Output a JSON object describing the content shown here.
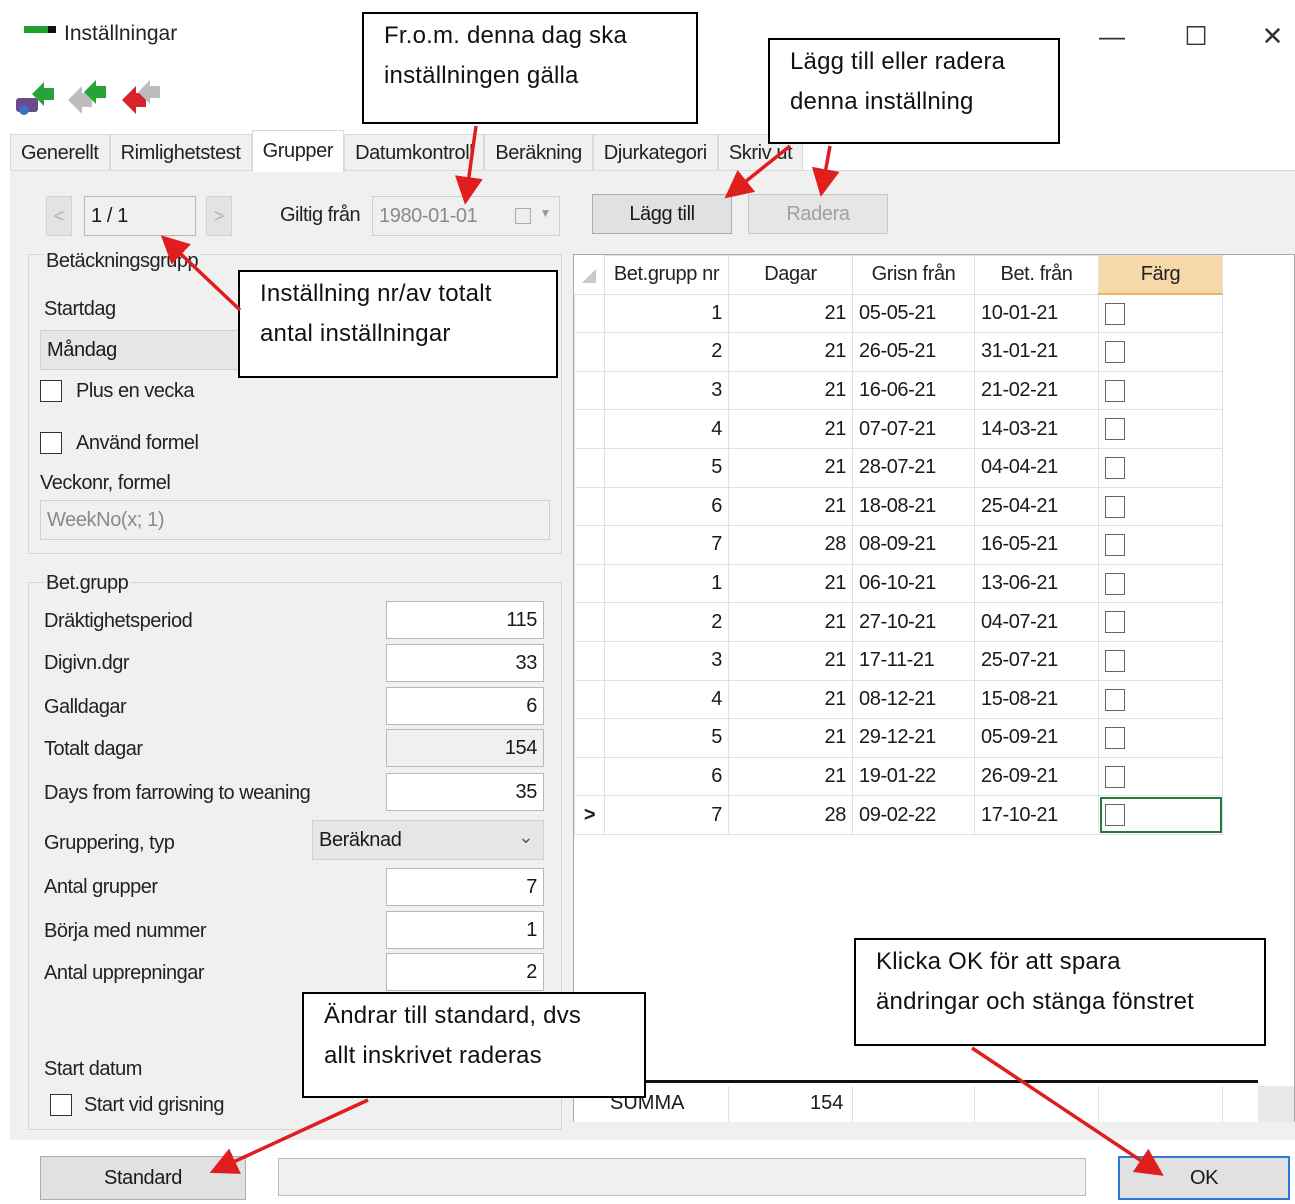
{
  "window": {
    "title": "Inställningar",
    "minimize_glyph": "—",
    "maximize_glyph": "☐",
    "close_glyph": "✕"
  },
  "toolbar": {
    "icons": [
      "add-setting-icon",
      "copy-setting-icon",
      "delete-setting-icon"
    ]
  },
  "tabs": [
    "Generellt",
    "Rimlighetstest",
    "Grupper",
    "Datumkontroll",
    "Beräkning",
    "Djurkategori",
    "Skriv ut"
  ],
  "active_tab": "Grupper",
  "navigator": {
    "prev": "<",
    "next": ">",
    "position": "1 / 1"
  },
  "valid_from": {
    "label": "Giltig från",
    "value": "1980-01-01"
  },
  "buttons": {
    "add": "Lägg till",
    "delete": "Radera",
    "standard": "Standard",
    "ok": "OK"
  },
  "betackning": {
    "group_title": "Betäckningsgrupp",
    "startdag_label": "Startdag",
    "startdag_value": "Måndag",
    "plus_week_label": "Plus en vecka",
    "use_formula_label": "Använd formel",
    "formula_label": "Veckonr, formel",
    "formula_value": "WeekNo(x; 1)"
  },
  "betgrupp": {
    "group_title": "Bet.grupp",
    "drakt_label": "Dräktighetsperiod",
    "drakt_value": "115",
    "digivn_label": "Digivn.dgr",
    "digivn_value": "33",
    "gall_label": "Galldagar",
    "gall_value": "6",
    "totalt_label": "Totalt dagar",
    "totalt_value": "154",
    "weaning_label": "Days from farrowing to weaning",
    "weaning_value": "35",
    "gruppering_label": "Gruppering, typ",
    "gruppering_value": "Beräknad",
    "antal_label": "Antal grupper",
    "antal_value": "7",
    "borja_label": "Börja med nummer",
    "borja_value": "1",
    "upprep_label": "Antal upprepningar",
    "upprep_value": "2",
    "startdatum_label": "Start datum",
    "start_grisning_label": "Start vid grisning"
  },
  "grid": {
    "columns": [
      "Bet.grupp nr",
      "Dagar",
      "Grisn från",
      "Bet. från",
      "Färg"
    ],
    "rows": [
      [
        "1",
        "21",
        "05-05-21",
        "10-01-21"
      ],
      [
        "2",
        "21",
        "26-05-21",
        "31-01-21"
      ],
      [
        "3",
        "21",
        "16-06-21",
        "21-02-21"
      ],
      [
        "4",
        "21",
        "07-07-21",
        "14-03-21"
      ],
      [
        "5",
        "21",
        "28-07-21",
        "04-04-21"
      ],
      [
        "6",
        "21",
        "18-08-21",
        "25-04-21"
      ],
      [
        "7",
        "28",
        "08-09-21",
        "16-05-21"
      ],
      [
        "1",
        "21",
        "06-10-21",
        "13-06-21"
      ],
      [
        "2",
        "21",
        "27-10-21",
        "04-07-21"
      ],
      [
        "3",
        "21",
        "17-11-21",
        "25-07-21"
      ],
      [
        "4",
        "21",
        "08-12-21",
        "15-08-21"
      ],
      [
        "5",
        "21",
        "29-12-21",
        "05-09-21"
      ],
      [
        "6",
        "21",
        "19-01-22",
        "26-09-21"
      ],
      [
        "7",
        "28",
        "09-02-22",
        "17-10-21"
      ]
    ],
    "current_row_marker": ">",
    "summary_label": "SUMMA",
    "summary_value": "154"
  },
  "callouts": {
    "valid_from_1": "Fr.o.m. denna dag ska",
    "valid_from_2": "inställningen gälla",
    "add_delete_1": "Lägg till eller radera",
    "add_delete_2": "denna inställning",
    "navigator_1": "Inställning nr/av totalt",
    "navigator_2": "antal inställningar",
    "standard_1": "Ändrar till standard, dvs",
    "standard_2": "allt inskrivet raderas",
    "ok_1": "Klicka OK för att spara",
    "ok_2": "ändringar och stänga fönstret"
  },
  "colors": {
    "accent_header": "#f6d8ab",
    "selected_cell": "#217a35",
    "arrow": "#e01e1e",
    "ok_border": "#2b7ad6"
  }
}
